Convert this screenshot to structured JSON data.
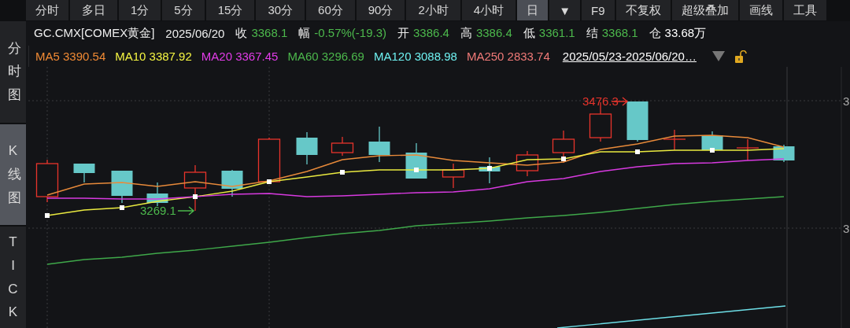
{
  "toolbar": {
    "buttons": [
      {
        "label": "分时",
        "selected": false
      },
      {
        "label": "多日",
        "selected": false
      },
      {
        "label": "1分",
        "selected": false
      },
      {
        "label": "5分",
        "selected": false
      },
      {
        "label": "15分",
        "selected": false
      },
      {
        "label": "30分",
        "selected": false
      },
      {
        "label": "60分",
        "selected": false
      },
      {
        "label": "90分",
        "selected": false
      },
      {
        "label": "2小时",
        "selected": false
      },
      {
        "label": "4小时",
        "selected": false
      },
      {
        "label": "日",
        "selected": true
      },
      {
        "label": "▼",
        "selected": false
      },
      {
        "label": "F9",
        "selected": false
      },
      {
        "label": "不复权",
        "selected": false
      },
      {
        "label": "超级叠加",
        "selected": false
      },
      {
        "label": "画线",
        "selected": false
      },
      {
        "label": "工具",
        "selected": false
      }
    ]
  },
  "sidebar": {
    "tabs": [
      {
        "label": "分时图",
        "selected": false
      },
      {
        "label": "K线图",
        "selected": true
      },
      {
        "label": "TICK",
        "selected": false
      }
    ]
  },
  "quote": {
    "symbol": "GC.CMX[COMEX黄金]",
    "date": "2025/06/20",
    "stats": [
      {
        "label": "收",
        "value": "3368.1",
        "color": "#4cb84c"
      },
      {
        "label": "幅",
        "value": "-0.57%(-19.3)",
        "color": "#4cb84c"
      },
      {
        "label": "开",
        "value": "3386.4",
        "color": "#4cb84c"
      },
      {
        "label": "高",
        "value": "3386.4",
        "color": "#4cb84c"
      },
      {
        "label": "低",
        "value": "3361.1",
        "color": "#4cb84c"
      },
      {
        "label": "结",
        "value": "3368.1",
        "color": "#4cb84c"
      },
      {
        "label": "仓",
        "value": "33.68万",
        "color": "#ffffff"
      }
    ]
  },
  "legend": {
    "averages": [
      {
        "name": "MA5",
        "value": "3390.54",
        "color": "#f08a34"
      },
      {
        "name": "MA10",
        "value": "3387.92",
        "color": "#f5f542"
      },
      {
        "name": "MA20",
        "value": "3367.45",
        "color": "#e23ce8"
      },
      {
        "name": "MA60",
        "value": "3296.69",
        "color": "#4cb84c"
      },
      {
        "name": "MA120",
        "value": "3088.98",
        "color": "#6ef0f0"
      },
      {
        "name": "MA250",
        "value": "2833.74",
        "color": "#f07a78"
      }
    ],
    "date_range": "2025/05/23-2025/06/20…"
  },
  "chart": {
    "high_label": "3476.3",
    "low_label": "3269.1",
    "axis_labels": [
      "3",
      "3"
    ]
  }
}
